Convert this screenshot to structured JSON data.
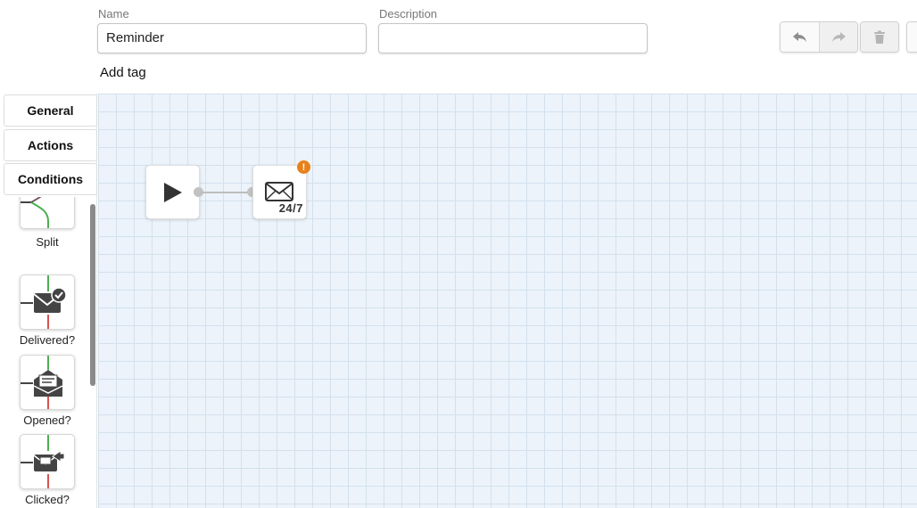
{
  "header": {
    "name_label": "Name",
    "name_value": "Reminder",
    "description_label": "Description",
    "description_value": "",
    "add_tag": "Add tag"
  },
  "toolbar": {
    "undo_icon": "undo-arrow-icon",
    "redo_icon": "redo-arrow-icon",
    "delete_icon": "trash-icon"
  },
  "sidebar": {
    "tabs": [
      {
        "label": "General"
      },
      {
        "label": "Actions"
      },
      {
        "label": "Conditions",
        "active": true
      }
    ],
    "items": [
      {
        "label": "Split",
        "icon": "split-branch-icon"
      },
      {
        "label": "Delivered?",
        "icon": "envelope-check-icon"
      },
      {
        "label": "Opened?",
        "icon": "open-envelope-icon"
      },
      {
        "label": "Clicked?",
        "icon": "envelope-click-icon"
      }
    ]
  },
  "canvas": {
    "start_node_icon": "play-icon",
    "email_node_icon": "envelope-icon",
    "email_node_tag": "24/7",
    "warning_badge": "!",
    "colors": {
      "grid_background": "#ecf3fa",
      "grid_line": "#d3e1ee",
      "warning": "#e8801a",
      "branch_yes": "#4caf50",
      "branch_no": "#d9534f"
    }
  }
}
